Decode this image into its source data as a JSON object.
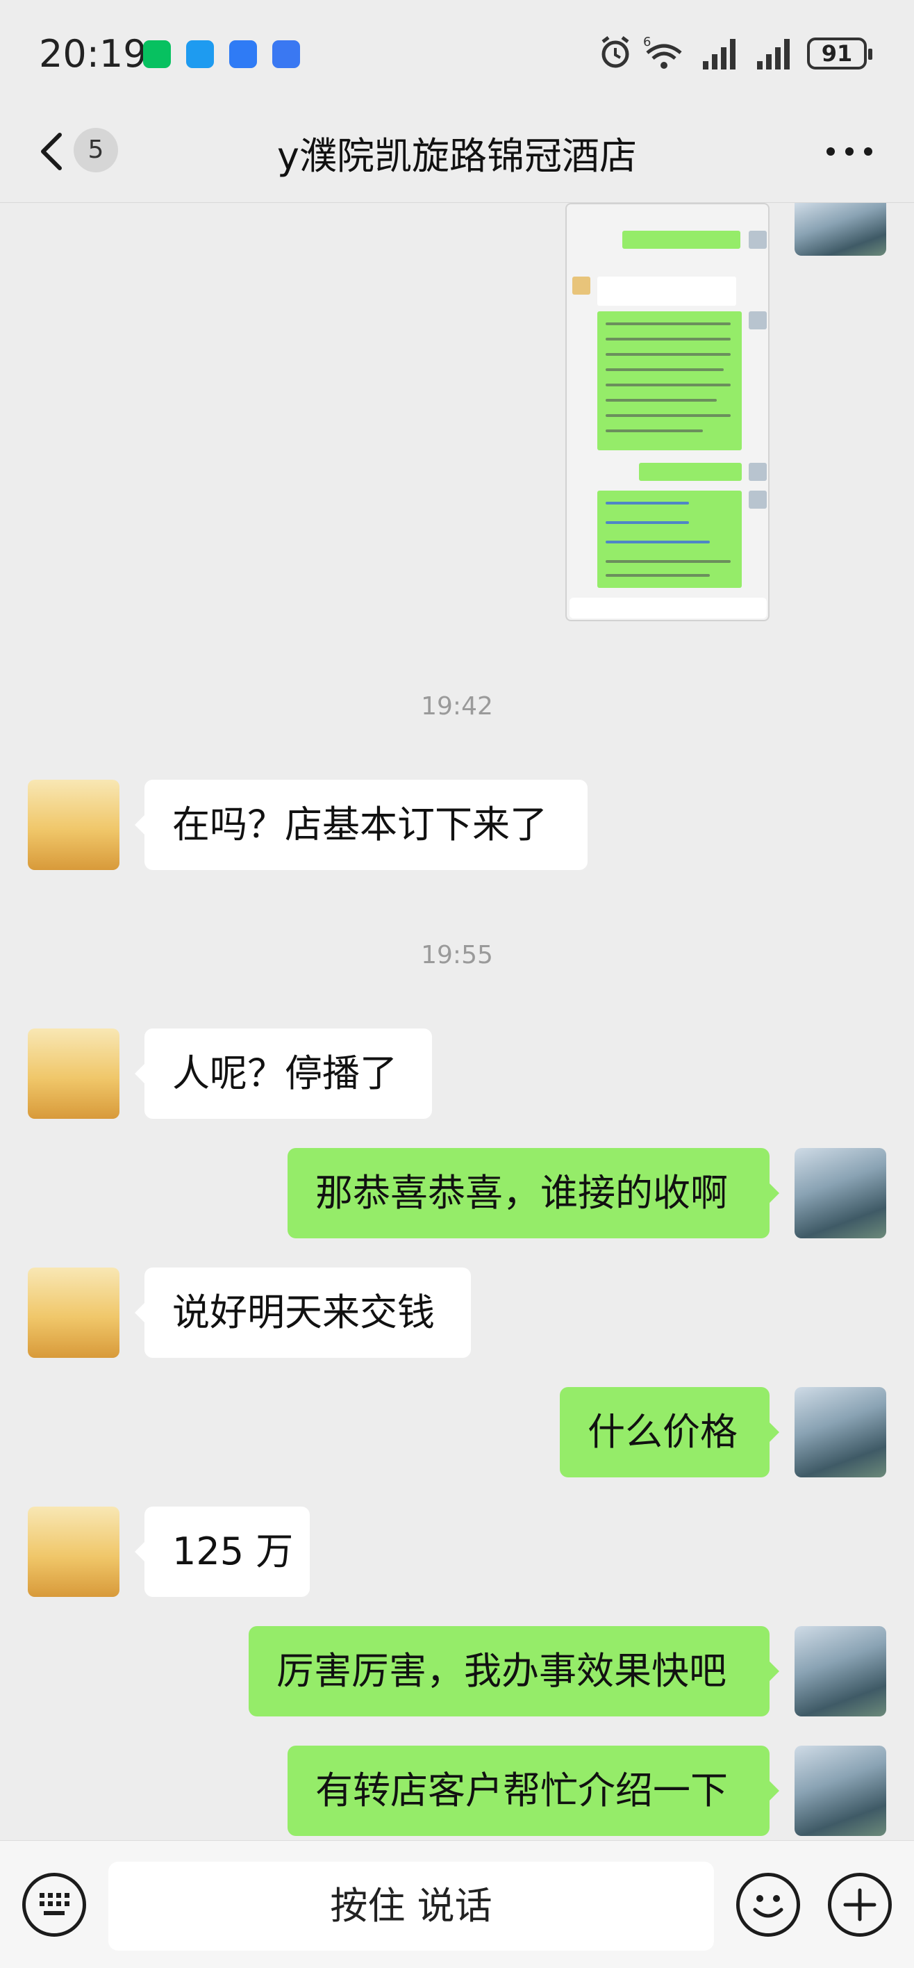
{
  "status_bar": {
    "time": "20:19",
    "battery": "91",
    "network_label": "6"
  },
  "header": {
    "back_count": "5",
    "title": "y濮院凯旋路锦冠酒店"
  },
  "messages": [
    {
      "type": "timestamp",
      "text": "19:42"
    },
    {
      "type": "received",
      "text": "在吗？店基本订下来了"
    },
    {
      "type": "timestamp",
      "text": "19:55"
    },
    {
      "type": "received",
      "text": "人呢？停播了"
    },
    {
      "type": "sent",
      "text": "那恭喜恭喜，谁接的收啊"
    },
    {
      "type": "received",
      "text": "说好明天来交钱"
    },
    {
      "type": "sent",
      "text": "什么价格"
    },
    {
      "type": "received",
      "text": "125 万"
    },
    {
      "type": "sent",
      "text": "厉害厉害，我办事效果快吧"
    },
    {
      "type": "sent",
      "text": "有转店客户帮忙介绍一下"
    }
  ],
  "input_bar": {
    "hold_to_talk": "按住 说话"
  },
  "icons": [
    "back-chevron-icon",
    "more-icon",
    "keyboard-icon",
    "emoji-icon",
    "plus-icon"
  ],
  "colors": {
    "background": "#ededed",
    "sent_bubble": "#95ec69",
    "received_bubble": "#ffffff",
    "timestamp": "#9a9a9a"
  }
}
